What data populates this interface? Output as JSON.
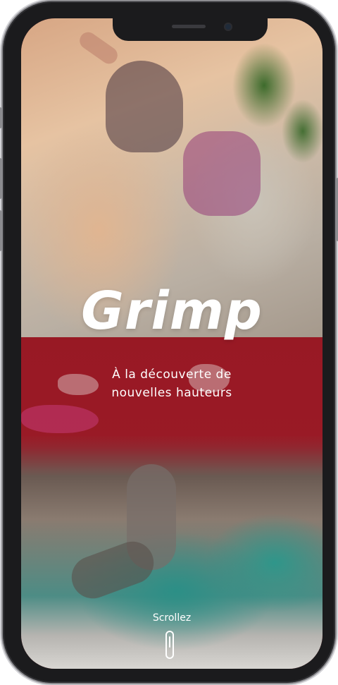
{
  "app": {
    "title": "Grimp",
    "tagline_line1": "À la découverte de",
    "tagline_line2": "nouvelles hauteurs"
  },
  "scroll": {
    "label": "Scrollez",
    "icon": "mouse-scroll-icon"
  },
  "colors": {
    "brand_red": "#9b1926",
    "text": "#ffffff",
    "device_frame": "#1b1b1d"
  },
  "images": {
    "top": "outdoor-rock-climber-photo",
    "bottom": "indoor-bouldering-gym-photo"
  }
}
